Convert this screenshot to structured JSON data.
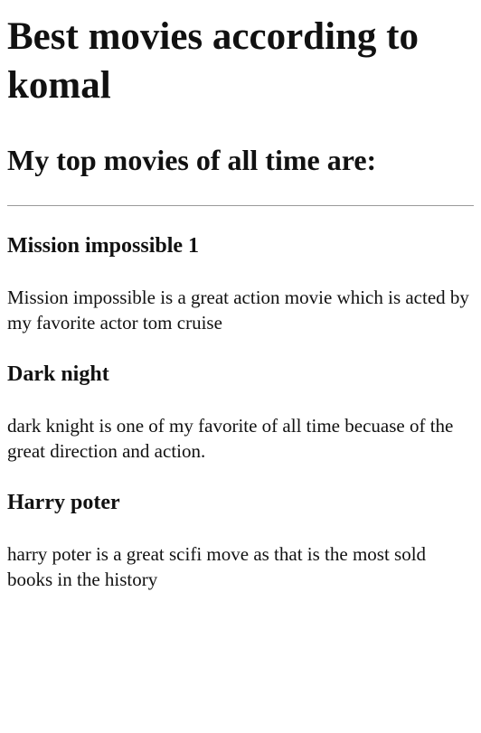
{
  "page": {
    "title": "Best movies according to komal",
    "subtitle": "My top movies of all time are:"
  },
  "movies": [
    {
      "name": "Mission impossible 1",
      "description": "Mission impossible is a great action movie which is acted by my favorite actor tom cruise"
    },
    {
      "name": "Dark night",
      "description": "dark knight is one of my favorite of all time becuase of the great direction and action."
    },
    {
      "name": "Harry poter",
      "description": "harry poter is a great scifi move as that is the most sold books in the history"
    }
  ]
}
